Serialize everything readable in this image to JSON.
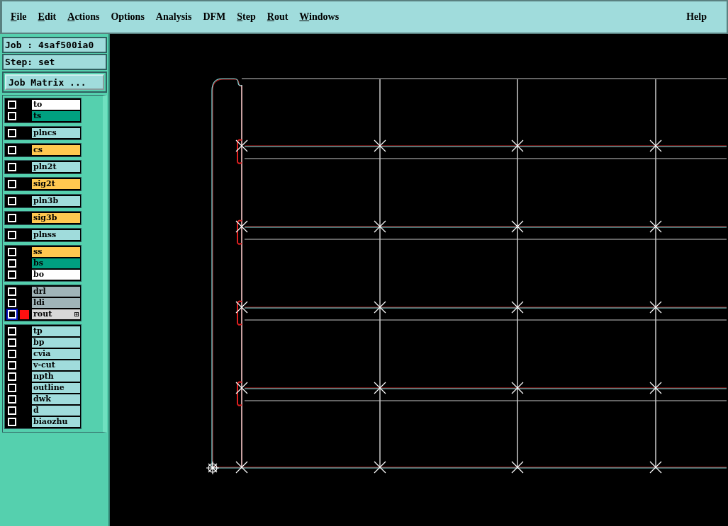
{
  "menu": [
    {
      "label": "File",
      "underlined": true
    },
    {
      "label": "Edit",
      "underlined": true
    },
    {
      "label": "Actions",
      "underlined": true
    },
    {
      "label": "Options",
      "underlined": false
    },
    {
      "label": "Analysis",
      "underlined": false
    },
    {
      "label": "DFM",
      "underlined": false
    },
    {
      "label": "Step",
      "underlined": true
    },
    {
      "label": "Rout",
      "underlined": true
    },
    {
      "label": "Windows",
      "underlined": true
    }
  ],
  "help_menu": "Help",
  "job": "Job : 4saf500ia0",
  "step": "Step: set",
  "job_matrix_button": "Job Matrix ...",
  "layer_groups": [
    {
      "layers": [
        {
          "name": "to",
          "color": "#ffffff",
          "checked": false,
          "selected": false
        },
        {
          "name": "ts",
          "color": "#00a080",
          "checked": false,
          "selected": false
        }
      ]
    },
    {
      "layers": [
        {
          "name": "plncs",
          "color": "#a0dcdc",
          "checked": false,
          "selected": false
        }
      ]
    },
    {
      "layers": [
        {
          "name": "cs",
          "color": "#ffc850",
          "checked": false,
          "selected": false
        }
      ]
    },
    {
      "layers": [
        {
          "name": "pln2t",
          "color": "#a0dcdc",
          "checked": false,
          "selected": false
        }
      ]
    },
    {
      "layers": [
        {
          "name": "sig2t",
          "color": "#ffc850",
          "checked": false,
          "selected": false
        }
      ]
    },
    {
      "layers": [
        {
          "name": "pln3b",
          "color": "#a0dcdc",
          "checked": false,
          "selected": false
        }
      ]
    },
    {
      "layers": [
        {
          "name": "sig3b",
          "color": "#ffc850",
          "checked": false,
          "selected": false
        }
      ]
    },
    {
      "layers": [
        {
          "name": "plnss",
          "color": "#a0dcdc",
          "checked": false,
          "selected": false
        }
      ]
    },
    {
      "layers": [
        {
          "name": "ss",
          "color": "#ffc850",
          "checked": false,
          "selected": false
        },
        {
          "name": "bs",
          "color": "#00a080",
          "checked": false,
          "selected": false
        },
        {
          "name": "bo",
          "color": "#ffffff",
          "checked": false,
          "selected": false
        }
      ]
    },
    {
      "layers": [
        {
          "name": "drl",
          "color": "#a0b4b8",
          "checked": false,
          "selected": false
        },
        {
          "name": "ldi",
          "color": "#a0b4b8",
          "checked": false,
          "selected": false
        },
        {
          "name": "rout",
          "color": "#d8d8d8",
          "checked": false,
          "selected": true
        }
      ]
    },
    {
      "layers": [
        {
          "name": "tp",
          "color": "#a0dcdc",
          "checked": false,
          "selected": false
        },
        {
          "name": "bp",
          "color": "#a0dcdc",
          "checked": false,
          "selected": false
        },
        {
          "name": "cvia",
          "color": "#a0dcdc",
          "checked": false,
          "selected": false
        },
        {
          "name": "v-cut",
          "color": "#a0dcdc",
          "checked": false,
          "selected": false
        },
        {
          "name": "npth",
          "color": "#a0dcdc",
          "checked": false,
          "selected": false
        },
        {
          "name": "outline",
          "color": "#a0dcdc",
          "checked": false,
          "selected": false
        },
        {
          "name": "dwk",
          "color": "#a0dcdc",
          "checked": false,
          "selected": false
        },
        {
          "name": "d",
          "color": "#a0dcdc",
          "checked": false,
          "selected": false
        },
        {
          "name": "biaozhu",
          "color": "#a0dcdc",
          "checked": false,
          "selected": false
        }
      ]
    }
  ]
}
